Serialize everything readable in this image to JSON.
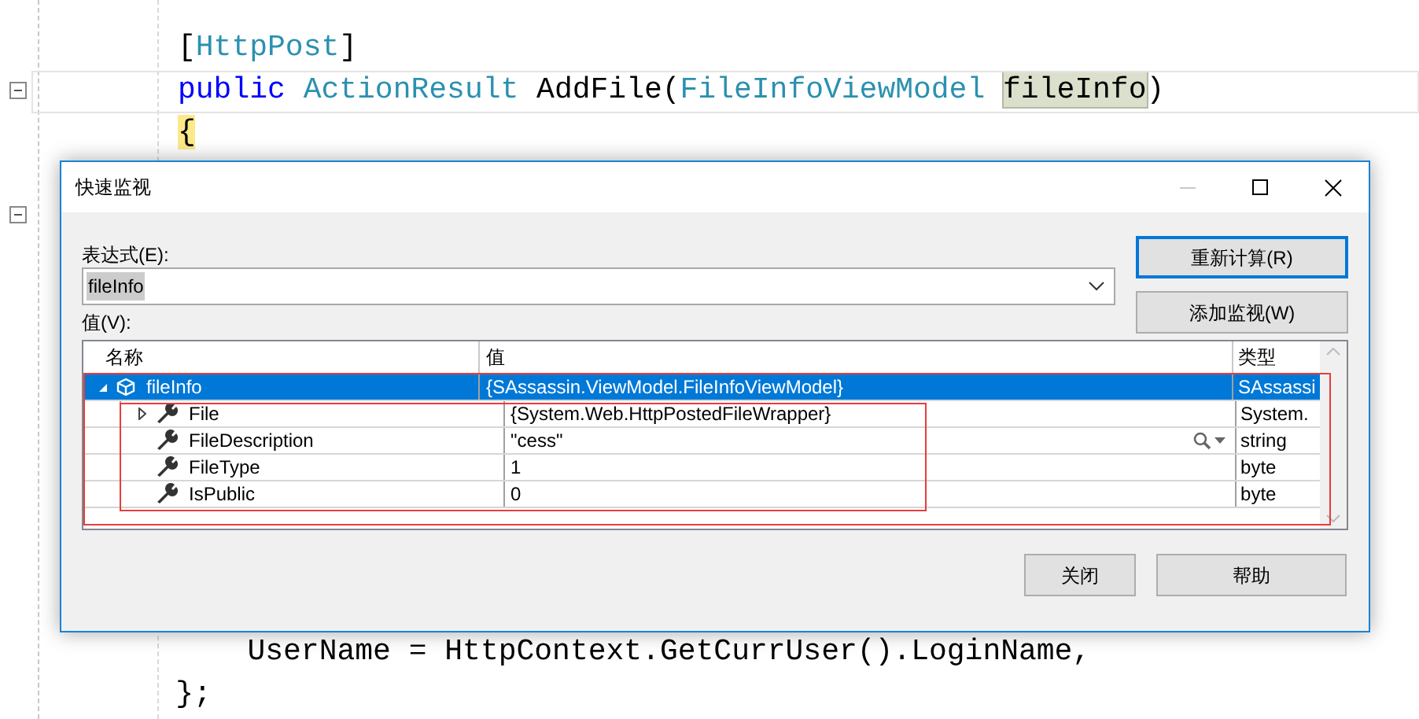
{
  "editor": {
    "lines_before": [
      [
        {
          "text": "[",
          "kind": "plain"
        },
        {
          "text": "HttpPost",
          "kind": "type"
        },
        {
          "text": "]",
          "kind": "plain"
        }
      ],
      [
        {
          "text": "public ",
          "kind": "keyword"
        },
        {
          "text": "ActionResult",
          "kind": "type"
        },
        {
          "text": " AddFile(",
          "kind": "plain"
        },
        {
          "text": "FileInfoViewModel ",
          "kind": "type"
        },
        {
          "text": "fileInfo",
          "kind": "reference"
        },
        {
          "text": ")",
          "kind": "plain"
        }
      ],
      [
        {
          "text": "{",
          "kind": "brace"
        }
      ]
    ],
    "lines_after": [
      [
        {
          "text": "        UserName = HttpContext.GetCurrUser().LoginName,",
          "kind": "plain"
        }
      ],
      [
        {
          "text": "    };",
          "kind": "plain"
        }
      ]
    ]
  },
  "dialog": {
    "title": "快速监视",
    "expression": {
      "label": "表达式(E):",
      "value": "fileInfo"
    },
    "side_buttons": [
      {
        "label": "重新计算(R)",
        "focused": true
      },
      {
        "label": "添加监视(W)",
        "focused": false
      }
    ],
    "values_label": "值(V):",
    "table": {
      "columns": [
        "名称",
        "值",
        "类型"
      ],
      "rows": [
        {
          "name": "fileInfo",
          "value": "{SAssassin.ViewModel.FileInfoViewModel}",
          "type": "SAssassi",
          "kind": "object",
          "selected": true,
          "expanded": true,
          "children": [
            {
              "name": "File",
              "value": "{System.Web.HttpPostedFileWrapper}",
              "type": "System.",
              "kind": "property",
              "selected": false,
              "expanded": false,
              "visualizer": false
            },
            {
              "name": "FileDescription",
              "value": "\"cess\"",
              "type": "string",
              "kind": "property",
              "selected": false,
              "visualizer": true
            },
            {
              "name": "FileType",
              "value": "1",
              "type": "byte",
              "kind": "property",
              "selected": false,
              "visualizer": false
            },
            {
              "name": "IsPublic",
              "value": "0",
              "type": "byte",
              "kind": "property",
              "selected": false,
              "visualizer": false
            }
          ]
        }
      ]
    },
    "bottom_buttons": [
      "关闭",
      "帮助"
    ]
  }
}
